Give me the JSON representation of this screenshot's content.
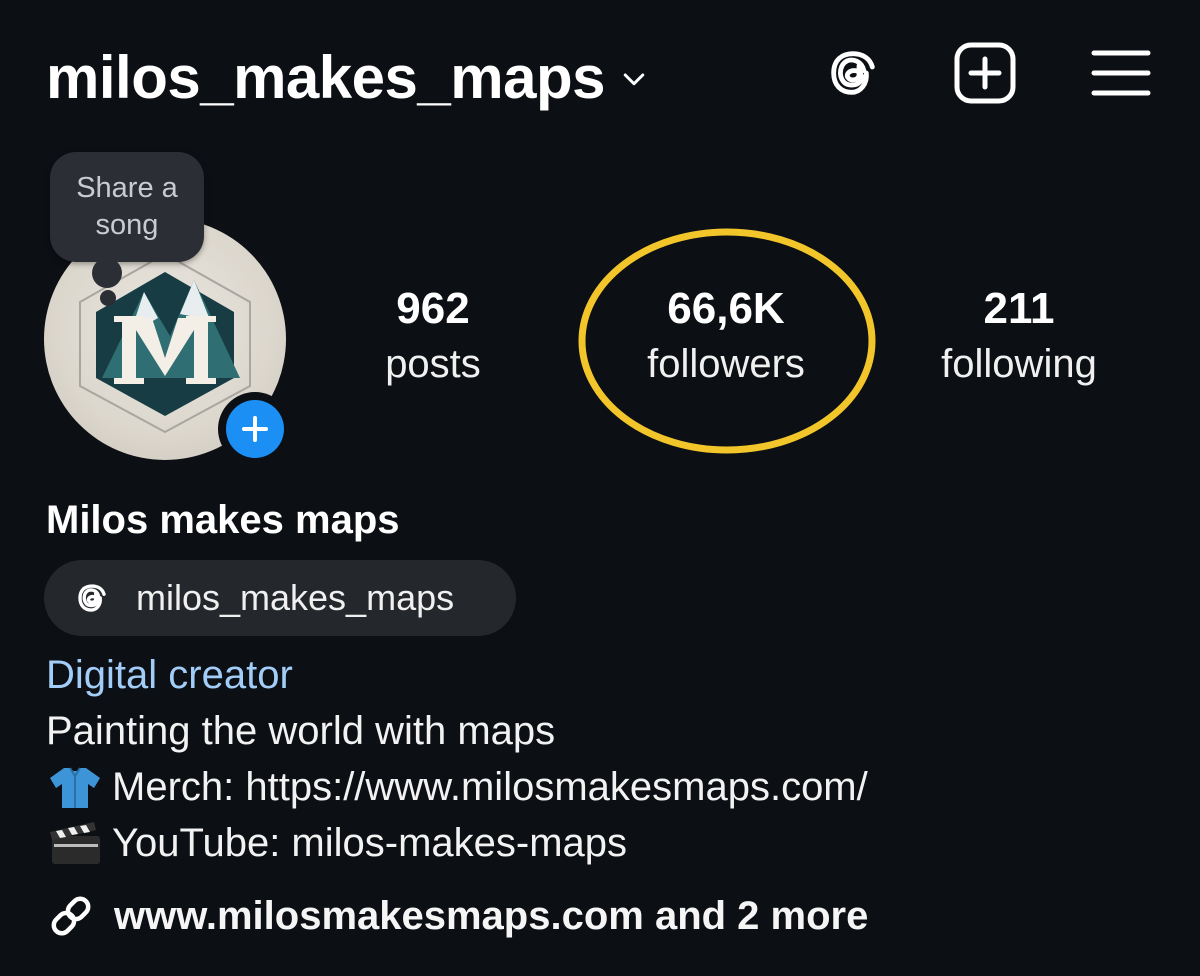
{
  "header": {
    "username": "milos_makes_maps"
  },
  "profile": {
    "share_song_label": "Share a song",
    "stats": {
      "posts": {
        "value": "962",
        "label": "posts"
      },
      "followers": {
        "value": "66,6K",
        "label": "followers"
      },
      "following": {
        "value": "211",
        "label": "following"
      }
    },
    "highlight_color": "#f2c62a",
    "display_name": "Milos makes maps",
    "threads_handle": "milos_makes_maps",
    "category": "Digital creator",
    "bio": {
      "line1": "Painting the world with maps",
      "line2_emoji": "shirt",
      "line2": "Merch: https://www.milosmakesmaps.com/",
      "line3_emoji": "clapper-board",
      "line3": " YouTube: milos-makes-maps"
    },
    "link": "www.milosmakesmaps.com and 2 more"
  },
  "colors": {
    "background": "#0c0f14",
    "accent_blue": "#1b8ff4",
    "category_link": "#a2cdf8"
  }
}
